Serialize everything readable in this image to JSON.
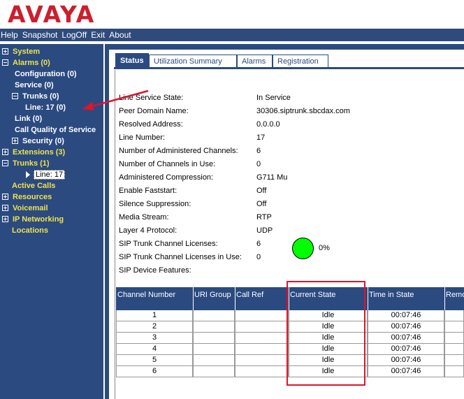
{
  "logo": {
    "text": "AVAYA",
    "color": "#cc1f2d"
  },
  "menu": [
    "Help",
    "Snapshot",
    "LogOff",
    "Exit",
    "About"
  ],
  "nav": {
    "items": [
      {
        "label": "System",
        "level": 0,
        "icon": "plus",
        "color": "yellow"
      },
      {
        "label": "Alarms (0)",
        "level": 0,
        "icon": "minus",
        "color": "yellow"
      },
      {
        "label": "Configuration (0)",
        "level": 2,
        "icon": "none",
        "color": "white"
      },
      {
        "label": "Service (0)",
        "level": 2,
        "icon": "none",
        "color": "white"
      },
      {
        "label": "Trunks (0)",
        "level": 1,
        "icon": "minus",
        "color": "white"
      },
      {
        "label": "Line: 17 (0)",
        "level": 3,
        "icon": "none",
        "color": "white"
      },
      {
        "label": "Link (0)",
        "level": 2,
        "icon": "none",
        "color": "white"
      },
      {
        "label": "Call Quality of Service",
        "level": 2,
        "icon": "none",
        "color": "white"
      },
      {
        "label": "Security (0)",
        "level": 1,
        "icon": "plus",
        "color": "white"
      },
      {
        "label": "Extensions (3)",
        "level": 0,
        "icon": "plus",
        "color": "yellow"
      },
      {
        "label": "Trunks (1)",
        "level": 0,
        "icon": "minus",
        "color": "yellow"
      },
      {
        "label": "Line: 17",
        "level": 4,
        "icon": "triangle",
        "color": "selected"
      },
      {
        "label": "Active Calls",
        "level": 0,
        "icon": "none",
        "color": "yellow"
      },
      {
        "label": "Resources",
        "level": 0,
        "icon": "plus",
        "color": "yellow"
      },
      {
        "label": "Voicemail",
        "level": 0,
        "icon": "plus",
        "color": "yellow"
      },
      {
        "label": "IP Networking",
        "level": 0,
        "icon": "plus",
        "color": "yellow"
      },
      {
        "label": "Locations",
        "level": 0,
        "icon": "none",
        "color": "yellow"
      }
    ]
  },
  "tabs": [
    {
      "label": "Status",
      "active": true
    },
    {
      "label": "Utilization Summary",
      "active": false
    },
    {
      "label": "Alarms",
      "active": false
    },
    {
      "label": "Registration",
      "active": false
    }
  ],
  "fields": [
    {
      "label": "Line Service State:",
      "value": "In Service"
    },
    {
      "label": "Peer Domain Name:",
      "value": "30306.siptrunk.sbcdax.com"
    },
    {
      "label": "Resolved Address:",
      "value": "0.0.0.0"
    },
    {
      "label": "Line Number:",
      "value": "17"
    },
    {
      "label": "Number of Administered Channels:",
      "value": "6"
    },
    {
      "label": "Number of Channels in Use:",
      "value": "0"
    },
    {
      "label": "Administered Compression:",
      "value": "G711 Mu"
    },
    {
      "label": "Enable Faststart:",
      "value": "Off"
    },
    {
      "label": "Silence Suppression:",
      "value": "Off"
    },
    {
      "label": "Media Stream:",
      "value": "RTP"
    },
    {
      "label": "Layer 4 Protocol:",
      "value": "UDP"
    },
    {
      "label": "SIP Trunk Channel Licenses:",
      "value": "6"
    },
    {
      "label": "SIP Trunk Channel Licenses in Use:",
      "value": "0"
    },
    {
      "label": "SIP Device Features:",
      "value": ""
    }
  ],
  "usage": {
    "percent_label": "0%",
    "fraction": 0,
    "color": "#00ff00"
  },
  "table": {
    "headers": [
      "Channel Number",
      "URI Group",
      "Call Ref",
      "Current State",
      "Time in State",
      "Remo"
    ],
    "rows": [
      [
        "1",
        "",
        "",
        "Idle",
        "00:07:46",
        ""
      ],
      [
        "2",
        "",
        "",
        "Idle",
        "00:07:46",
        ""
      ],
      [
        "3",
        "",
        "",
        "Idle",
        "00:07:46",
        ""
      ],
      [
        "4",
        "",
        "",
        "Idle",
        "00:07:46",
        ""
      ],
      [
        "5",
        "",
        "",
        "Idle",
        "00:07:46",
        ""
      ],
      [
        "6",
        "",
        "",
        "Idle",
        "00:07:46",
        ""
      ]
    ]
  },
  "colors": {
    "nav_bg": "#2b4a80",
    "nav_yellow": "#f0e24a",
    "highlight": "#e0142a"
  }
}
